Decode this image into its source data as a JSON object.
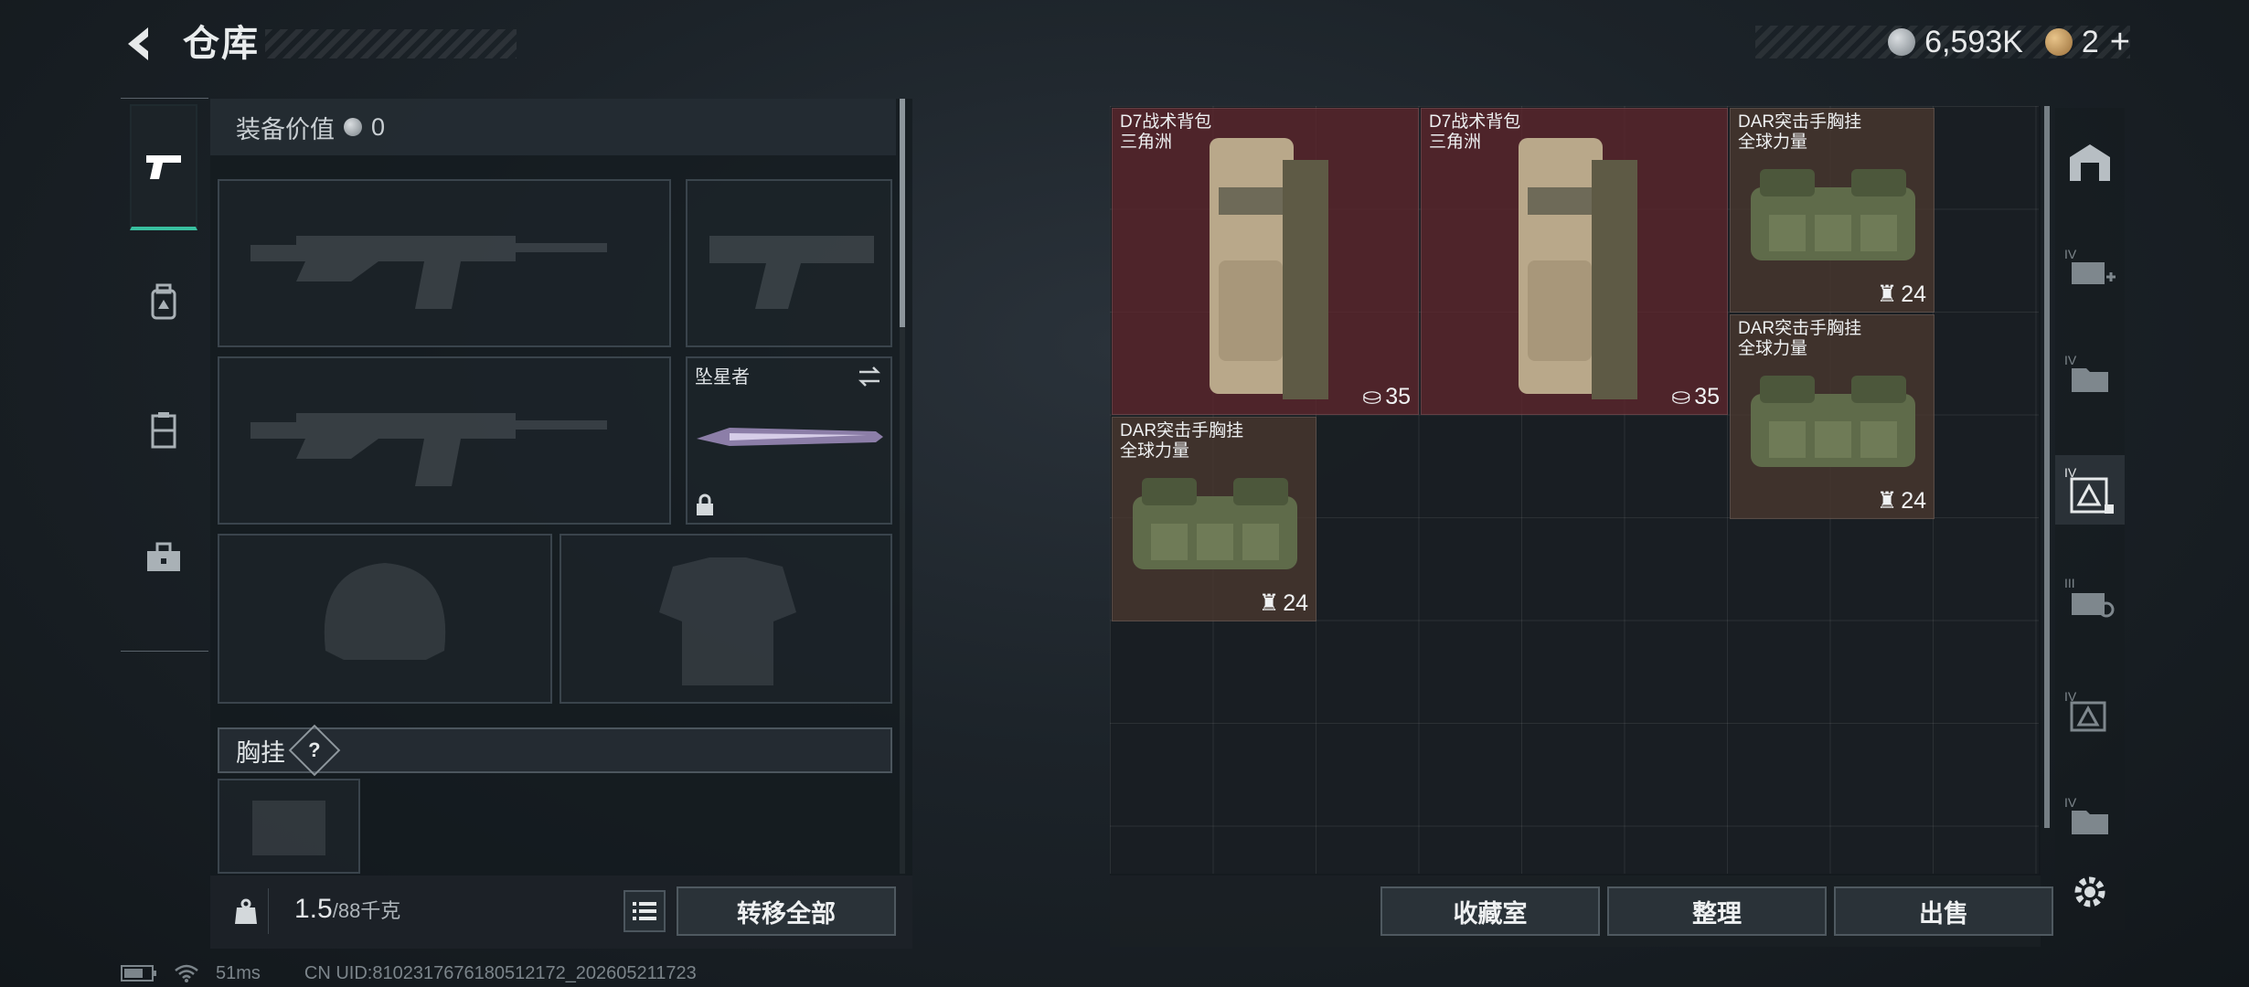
{
  "header": {
    "title": "仓库",
    "currency_silver": "6,593K",
    "currency_gold": "2",
    "add_label": "+"
  },
  "left_tabs": [
    "weapons",
    "backpack",
    "armor",
    "toolbox"
  ],
  "loadout": {
    "equip_value_label": "装备价值",
    "equip_value": "0",
    "melee_name": "坠星者",
    "chest_label": "胸挂",
    "help_label": "?",
    "weight_current": "1.5",
    "weight_max": "/88千克",
    "transfer_all": "转移全部"
  },
  "stash": {
    "items": [
      {
        "name1": "D7战术背包",
        "name2": "三角洲",
        "count": "35"
      },
      {
        "name1": "D7战术背包",
        "name2": "三角洲",
        "count": "35"
      },
      {
        "name1": "DAR突击手胸挂",
        "name2": "全球力量",
        "count": "24"
      },
      {
        "name1": "DAR突击手胸挂",
        "name2": "全球力量",
        "count": "24"
      },
      {
        "name1": "DAR突击手胸挂",
        "name2": "全球力量",
        "count": "24"
      }
    ],
    "buttons": {
      "collection": "收藏室",
      "organize": "整理",
      "sell": "出售"
    }
  },
  "right_tabs": [
    "storage-main",
    "IV",
    "IV",
    "IV",
    "III",
    "IV",
    "IV"
  ],
  "footer": {
    "ping": "51ms",
    "uid": "CN UID:810231767618051​2172_202605211723"
  },
  "colors": {
    "accent": "#39c0a0",
    "item_red": "#5e262d",
    "item_brown": "#4a3830"
  }
}
